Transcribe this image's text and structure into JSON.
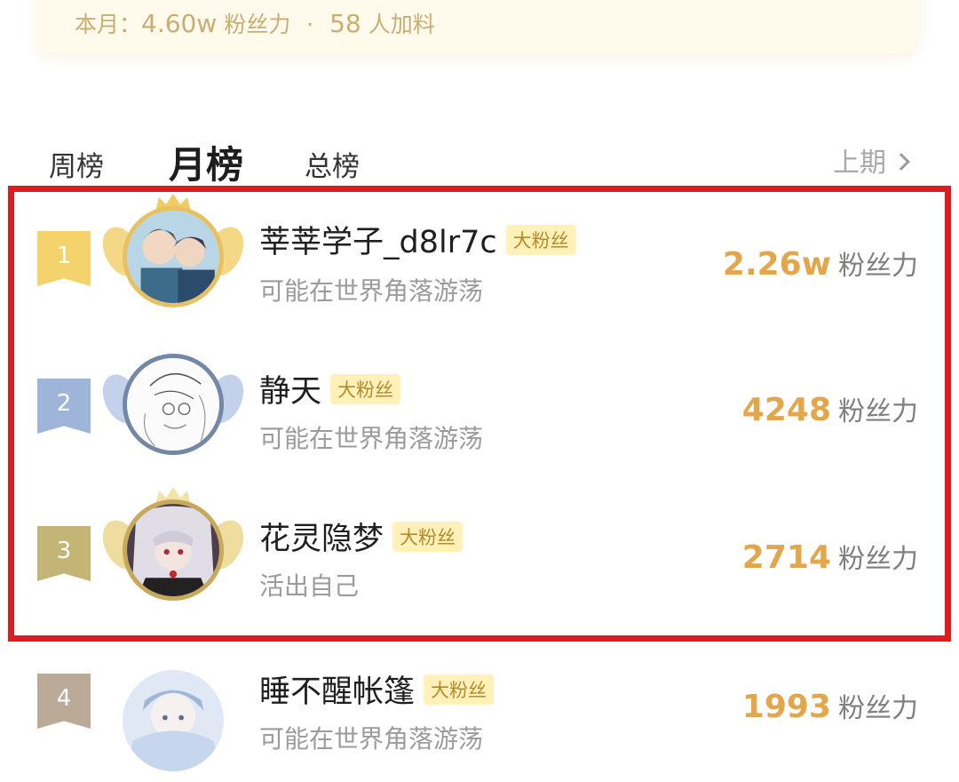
{
  "summary": {
    "prefix": "本月：",
    "power_value": "4.60w",
    "power_unit": "粉丝力",
    "separator": "·",
    "join_count": "58",
    "join_unit": "人加料"
  },
  "tabs": {
    "weekly": "周榜",
    "monthly": "月榜",
    "total": "总榜",
    "previous_period": "上期"
  },
  "rankings": [
    {
      "rank": "1",
      "username": "莘莘学子_d8lr7c",
      "badge": "大粉丝",
      "bio": "可能在世界角落游荡",
      "score": "2.26w",
      "unit": "粉丝力",
      "ribbon_color": "#f5d36c",
      "ring_color": "#e6c061"
    },
    {
      "rank": "2",
      "username": "静天",
      "badge": "大粉丝",
      "bio": "可能在世界角落游荡",
      "score": "4248",
      "unit": "粉丝力",
      "ribbon_color": "#9eb4d8",
      "ring_color": "#7388a6"
    },
    {
      "rank": "3",
      "username": "花灵隐梦",
      "badge": "大粉丝",
      "bio": "活出自己",
      "score": "2714",
      "unit": "粉丝力",
      "ribbon_color": "#c2b575",
      "ring_color": "#c8a95a"
    },
    {
      "rank": "4",
      "username": "睡不醒帐篷",
      "badge": "大粉丝",
      "bio": "可能在世界角落游荡",
      "score": "1993",
      "unit": "粉丝力",
      "ribbon_color": "#bcaa99",
      "ring_color": "#ffffff"
    }
  ],
  "colors": {
    "highlight_border": "#e01b20",
    "score_color": "#e4a64a",
    "badge_bg": "#fff1b8",
    "badge_text": "#b58a2d"
  }
}
